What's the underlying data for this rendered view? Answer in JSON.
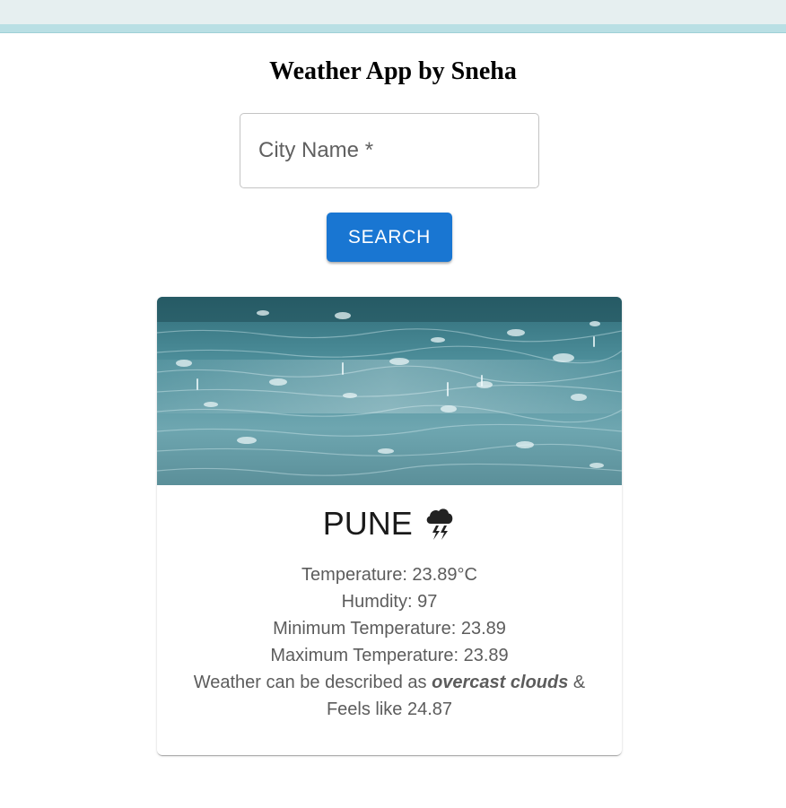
{
  "app": {
    "title": "Weather App by Sneha"
  },
  "search": {
    "placeholder": "City Name *",
    "value": "",
    "button_label": "SEARCH"
  },
  "card": {
    "image_icon": "rain-puddle-photo",
    "city": "PUNE",
    "weather_icon": "thunderstorm-cloud-icon",
    "temperature_label": "Temperature: 23.89°C",
    "humidity_label": "Humdity: 97",
    "min_temp_label": "Minimum Temperature: 23.89",
    "max_temp_label": "Maximum Temperature: 23.89",
    "description_prefix": "Weather can be described as ",
    "description_value": "overcast clouds",
    "description_suffix": " &",
    "feels_like_label": "Feels like 24.87"
  },
  "colors": {
    "accent": "#1976d2",
    "topbar": "#e6eff0",
    "topbar_border": "#b9dfe4",
    "water": "#4a8a96"
  }
}
